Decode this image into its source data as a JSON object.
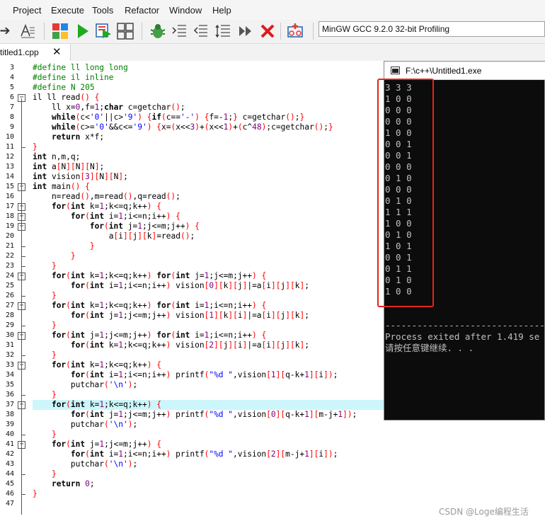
{
  "menu": [
    "Project",
    "Execute",
    "Tools",
    "Refactor",
    "Window",
    "Help"
  ],
  "toolbar": {
    "icons": [
      "arrow-icon",
      "text-format-icon",
      "grid-icon",
      "run-icon",
      "compile-run-icon",
      "layout-icon",
      "debug-icon",
      "indent-icon",
      "unindent-icon",
      "list-icon",
      "step-icon",
      "stop-icon",
      "profile-icon"
    ],
    "compiler": "MinGW GCC 9.2.0 32-bit Profiling"
  },
  "tab": {
    "label": "titled1.cpp",
    "close": "✕"
  },
  "editor": {
    "current_line": 37,
    "lines": [
      {
        "n": "3",
        "text": "#define ll long long"
      },
      {
        "n": "4",
        "text": "#define il inline"
      },
      {
        "n": "5",
        "text": "#define N 205"
      },
      {
        "n": "6",
        "text": "il ll read() {"
      },
      {
        "n": "7",
        "text": "    ll x=0,f=1;char c=getchar();"
      },
      {
        "n": "8",
        "text": "    while(c<'0'||c>'9') {if(c=='-') {f=-1;} c=getchar();}"
      },
      {
        "n": "9",
        "text": "    while(c>='0'&&c<='9') {x=(x<<3)+(x<<1)+(c^48);c=getchar();}"
      },
      {
        "n": "10",
        "text": "    return x*f;"
      },
      {
        "n": "11",
        "text": "}"
      },
      {
        "n": "12",
        "text": "int n,m,q;"
      },
      {
        "n": "13",
        "text": "int a[N][N][N];"
      },
      {
        "n": "14",
        "text": "int vision[3][N][N];"
      },
      {
        "n": "15",
        "text": "int main() {"
      },
      {
        "n": "16",
        "text": "    n=read(),m=read(),q=read();"
      },
      {
        "n": "17",
        "text": "    for(int k=1;k<=q;k++) {"
      },
      {
        "n": "18",
        "text": "        for(int i=1;i<=n;i++) {"
      },
      {
        "n": "19",
        "text": "            for(int j=1;j<=m;j++) {"
      },
      {
        "n": "20",
        "text": "                a[i][j][k]=read();"
      },
      {
        "n": "21",
        "text": "            }"
      },
      {
        "n": "22",
        "text": "        }"
      },
      {
        "n": "23",
        "text": "    }"
      },
      {
        "n": "24",
        "text": "    for(int k=1;k<=q;k++) for(int j=1;j<=m;j++) {"
      },
      {
        "n": "25",
        "text": "        for(int i=1;i<=n;i++) vision[0][k][j]|=a[i][j][k];"
      },
      {
        "n": "26",
        "text": "    }"
      },
      {
        "n": "27",
        "text": "    for(int k=1;k<=q;k++) for(int i=1;i<=n;i++) {"
      },
      {
        "n": "28",
        "text": "        for(int j=1;j<=m;j++) vision[1][k][i]|=a[i][j][k];"
      },
      {
        "n": "29",
        "text": "    }"
      },
      {
        "n": "30",
        "text": "    for(int j=1;j<=m;j++) for(int i=1;i<=n;i++) {"
      },
      {
        "n": "31",
        "text": "        for(int k=1;k<=q;k++) vision[2][j][i]|=a[i][j][k];"
      },
      {
        "n": "32",
        "text": "    }"
      },
      {
        "n": "33",
        "text": "    for(int k=1;k<=q;k++) {"
      },
      {
        "n": "34",
        "text": "        for(int i=1;i<=n;i++) printf(\"%d \",vision[1][q-k+1][i]);"
      },
      {
        "n": "35",
        "text": "        putchar('\\n');"
      },
      {
        "n": "36",
        "text": "    }"
      },
      {
        "n": "37",
        "text": "    for(int k=1;k<=q;k++) {"
      },
      {
        "n": "38",
        "text": "        for(int j=1;j<=m;j++) printf(\"%d \",vision[0][q-k+1][m-j+1]);"
      },
      {
        "n": "39",
        "text": "        putchar('\\n');"
      },
      {
        "n": "40",
        "text": "    }"
      },
      {
        "n": "41",
        "text": "    for(int j=1;j<=m;j++) {"
      },
      {
        "n": "42",
        "text": "        for(int i=1;i<=n;i++) printf(\"%d \",vision[2][m-j+1][i]);"
      },
      {
        "n": "43",
        "text": "        putchar('\\n');"
      },
      {
        "n": "44",
        "text": "    }"
      },
      {
        "n": "45",
        "text": "    return 0;"
      },
      {
        "n": "46",
        "text": "}"
      },
      {
        "n": "47",
        "text": ""
      }
    ]
  },
  "console": {
    "title": "F:\\c++\\Untitled1.exe",
    "output": [
      "3 3 3",
      "1 0 0",
      "0 0 0",
      "0 0 0",
      "1 0 0",
      "0 0 1",
      "0 0 1",
      "0 0 0",
      "0 1 0",
      "0 0 0",
      "0 1 0",
      "1 1 1",
      "1 0 0",
      "0 1 0",
      "1 0 1",
      "0 0 1",
      "0 1 1",
      "0 1 0",
      "1 0 0",
      "",
      "",
      "--------------------------------",
      "Process exited after 1.419 se",
      "请按任意键继续. . ."
    ]
  },
  "watermark": "CSDN @Loge编程生活",
  "colors": {
    "keyword": "#000000",
    "preprocessor": "#008000",
    "number": "#800080",
    "brace": "#ff0000",
    "string": "#0000ff",
    "current_line_bg": "#ccf6fb",
    "annotation_box": "#e8231b"
  }
}
